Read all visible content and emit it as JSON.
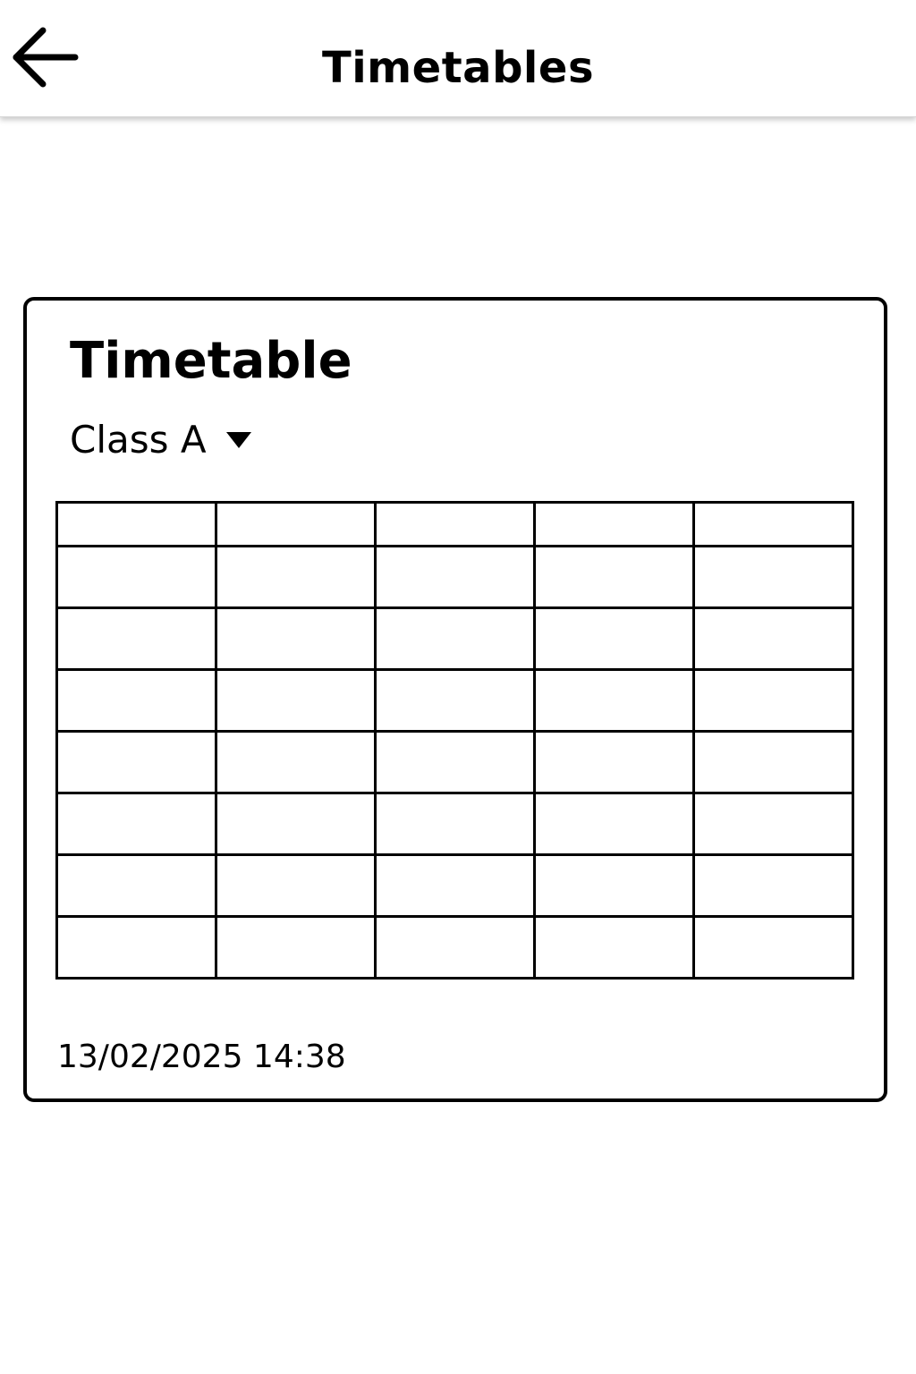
{
  "header": {
    "title": "Timetables",
    "back_icon": "arrow-left-icon"
  },
  "card": {
    "title": "Timetable",
    "class_select": {
      "selected": "Class A",
      "icon": "caret-down-icon"
    },
    "table": {
      "columns": [
        "",
        "",
        "",
        "",
        ""
      ],
      "rows": [
        [
          "",
          "",
          "",
          "",
          ""
        ],
        [
          "",
          "",
          "",
          "",
          ""
        ],
        [
          "",
          "",
          "",
          "",
          ""
        ],
        [
          "",
          "",
          "",
          "",
          ""
        ],
        [
          "",
          "",
          "",
          "",
          ""
        ],
        [
          "",
          "",
          "",
          "",
          ""
        ],
        [
          "",
          "",
          "",
          "",
          ""
        ]
      ]
    },
    "timestamp": "13/02/2025 14:38"
  },
  "colors": {
    "background": "#ffffff",
    "foreground": "#000000"
  }
}
